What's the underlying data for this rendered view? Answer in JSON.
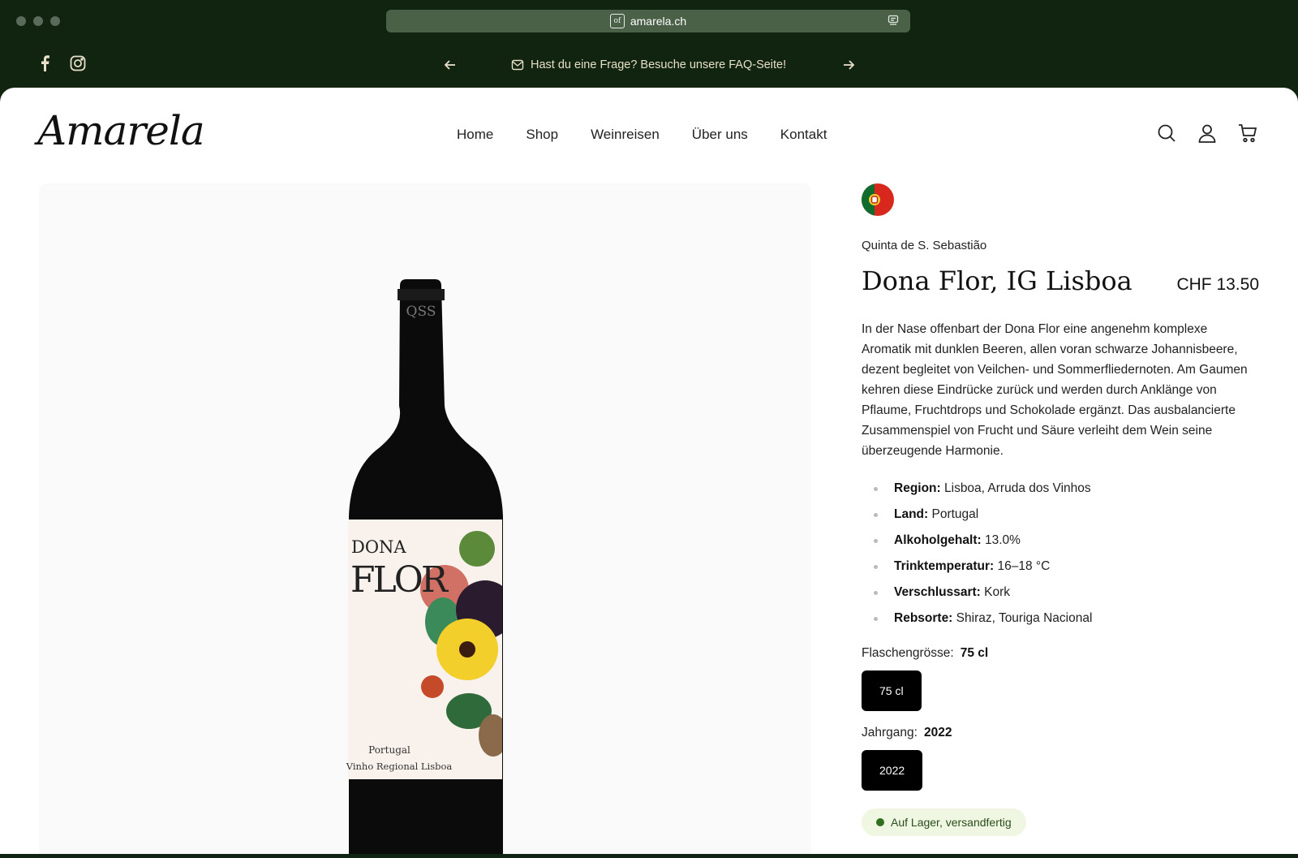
{
  "browser": {
    "url": "amarela.ch",
    "favicon_text": "of"
  },
  "announcement": {
    "message": "Hast du eine Frage? Besuche unsere FAQ-Seite!"
  },
  "header": {
    "logo": "Amarela",
    "nav": [
      "Home",
      "Shop",
      "Weinreisen",
      "Über uns",
      "Kontakt"
    ]
  },
  "product": {
    "producer": "Quinta de S. Sebastião",
    "title": "Dona Flor, IG Lisboa",
    "price": "CHF 13.50",
    "description": "In der Nase offenbart der Dona Flor eine angenehm komplexe Aromatik mit dunklen Beeren, allen voran schwarze Johannisbeere, dezent begleitet von Veilchen- und Sommerfliedernoten. Am Gaumen kehren diese Eindrücke zurück und werden durch Anklänge von Pflaume, Fruchtdrops und Schokolade ergänzt. Das ausbalancierte Zusammenspiel von Frucht und Säure verleiht dem Wein seine überzeugende Harmonie.",
    "specs": [
      {
        "label": "Region:",
        "value": "Lisboa, Arruda dos Vinhos"
      },
      {
        "label": "Land:",
        "value": "Portugal"
      },
      {
        "label": "Alkoholgehalt:",
        "value": "13.0%"
      },
      {
        "label": "Trinktemperatur:",
        "value": "16–18 °C"
      },
      {
        "label": "Verschlussart:",
        "value": "Kork"
      },
      {
        "label": "Rebsorte:",
        "value": "Shiraz, Touriga Nacional"
      }
    ],
    "size": {
      "label": "Flaschengrösse:",
      "selected": "75 cl",
      "option": "75 cl"
    },
    "vintage": {
      "label": "Jahrgang:",
      "selected": "2022",
      "option": "2022"
    },
    "stock": "Auf Lager, versandfertig",
    "bottle_label": {
      "capsule": "QSS",
      "line1": "DONA",
      "line2": "FLOR",
      "line3": "Portugal",
      "line4": "Vinho Regional Lisboa"
    }
  },
  "colors": {
    "topbar": "#102410",
    "urlbar": "#4a6148",
    "accent": "#000000",
    "stock_bg": "#eff6e2"
  }
}
